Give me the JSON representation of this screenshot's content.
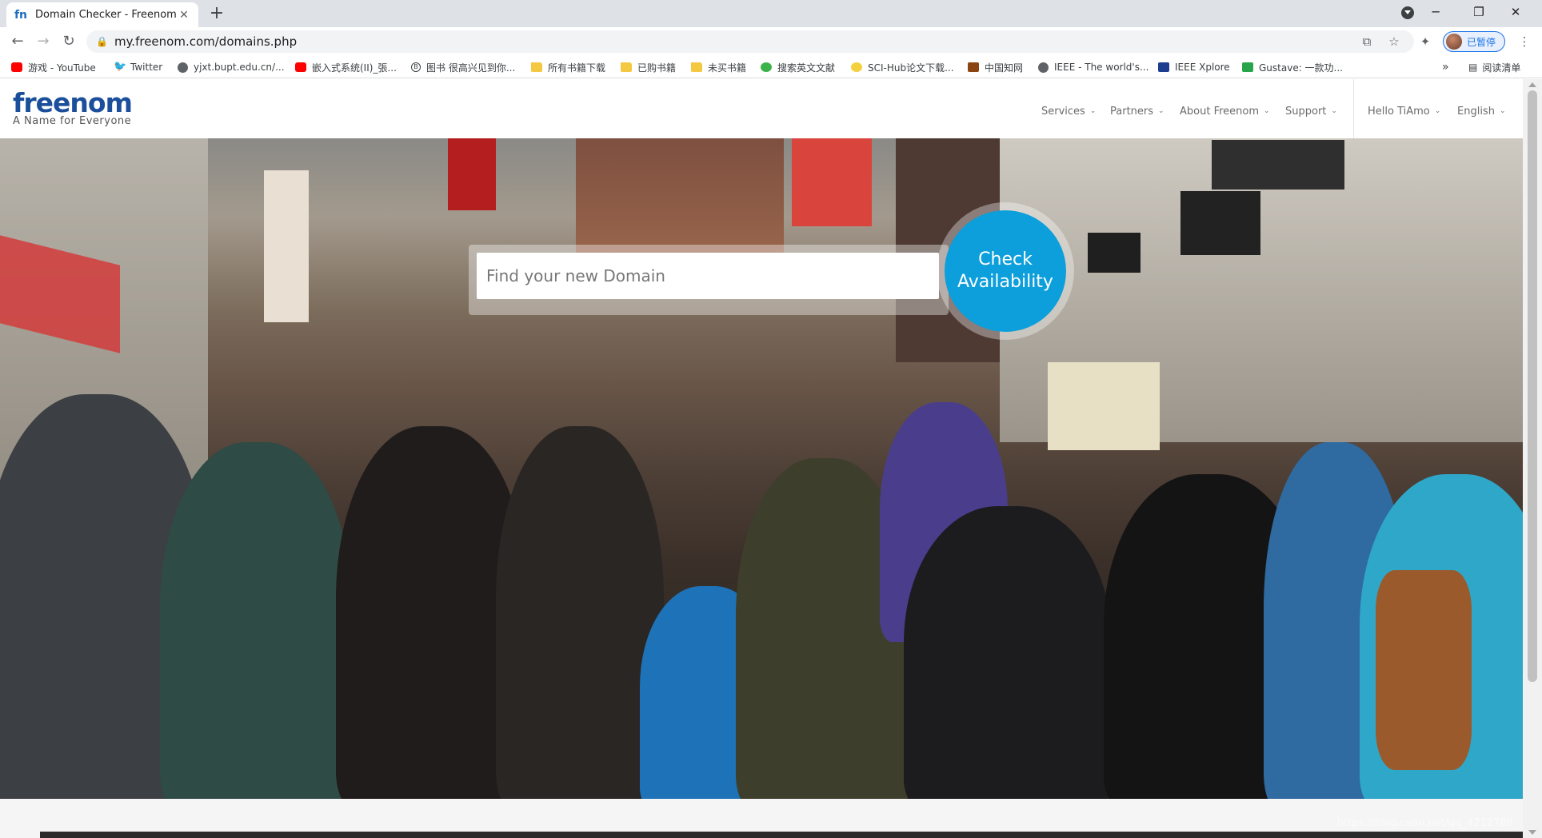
{
  "browser": {
    "tab_title": "Domain Checker - Freenom",
    "tab_favicon": "fn",
    "new_tab": "+",
    "url": "my.freenom.com/domains.php",
    "profile_label": "已暂停",
    "bookmarks": [
      {
        "label": "游戏 - YouTube",
        "icon": "youtube-icon"
      },
      {
        "label": "Twitter",
        "icon": "twitter-icon"
      },
      {
        "label": "yjxt.bupt.edu.cn/...",
        "icon": "globe-icon"
      },
      {
        "label": "嵌入式系统(II)_張...",
        "icon": "youtube-icon"
      },
      {
        "label": "图书 很高兴见到你...",
        "icon": "b-icon"
      },
      {
        "label": "所有书籍下载",
        "icon": "folder-icon"
      },
      {
        "label": "已购书籍",
        "icon": "folder-icon"
      },
      {
        "label": "未买书籍",
        "icon": "folder-icon"
      },
      {
        "label": "搜索英文文献",
        "icon": "green-icon"
      },
      {
        "label": "SCI-Hub论文下载...",
        "icon": "sci-icon"
      },
      {
        "label": "中国知网",
        "icon": "cnki-icon"
      },
      {
        "label": "IEEE - The world's...",
        "icon": "globe-icon"
      },
      {
        "label": "IEEE Xplore",
        "icon": "ieee-icon"
      },
      {
        "label": "Gustave: 一款功...",
        "icon": "gx-icon"
      }
    ],
    "bookmarks_overflow": "»",
    "reading_list": "阅读清单"
  },
  "site": {
    "logo_free": "free",
    "logo_nom": "nom",
    "tagline": "A Name for Everyone",
    "nav": [
      {
        "label": "Services"
      },
      {
        "label": "Partners"
      },
      {
        "label": "About Freenom"
      },
      {
        "label": "Support"
      },
      {
        "label": "Hello TiAmo"
      },
      {
        "label": "English"
      }
    ]
  },
  "hero": {
    "search_placeholder": "Find your new Domain",
    "check_line1": "Check",
    "check_line2": "Availability"
  },
  "watermark": "https://blog.csdn.net/qq_4212789",
  "colors": {
    "brand_blue": "#1b4e9b",
    "check_button": "#0c9fdc"
  }
}
